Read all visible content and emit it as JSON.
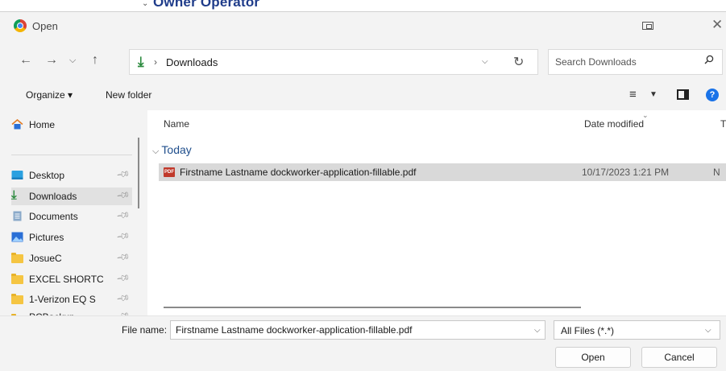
{
  "background_window": {
    "partial_title": "Owner Operator"
  },
  "dialog": {
    "title": "Open",
    "nav": {
      "back_icon": "arrow-left-icon",
      "forward_icon": "arrow-right-icon",
      "recent_icon": "chevron-down-icon",
      "up_icon": "arrow-up-icon"
    },
    "address": {
      "location": "Downloads",
      "separator": "›"
    },
    "search": {
      "placeholder": "Search Downloads"
    },
    "toolbar": {
      "organize": "Organize ▾",
      "new_folder": "New folder"
    },
    "nav_pane": {
      "items": [
        {
          "label": "Home",
          "icon": "home-icon"
        },
        {
          "label": "Desktop",
          "icon": "desktop-icon",
          "pinned": true
        },
        {
          "label": "Downloads",
          "icon": "downloads-icon",
          "pinned": true,
          "selected": true
        },
        {
          "label": "Documents",
          "icon": "documents-icon",
          "pinned": true
        },
        {
          "label": "Pictures",
          "icon": "pictures-icon",
          "pinned": true
        },
        {
          "label": "JosueC",
          "icon": "folder-icon",
          "pinned": true
        },
        {
          "label": "EXCEL SHORTC",
          "icon": "folder-icon",
          "pinned": true
        },
        {
          "label": "1-Verizon EQ S",
          "icon": "folder-icon",
          "pinned": true
        },
        {
          "label": "PCBackup",
          "icon": "folder-icon",
          "pinned": true
        }
      ]
    },
    "file_list": {
      "columns": {
        "name": "Name",
        "date": "Date modified",
        "type_partial": "T"
      },
      "groups": [
        {
          "label": "Today",
          "files": [
            {
              "name": "Firstname Lastname dockworker-application-fillable.pdf",
              "date_modified": "10/17/2023 1:21 PM",
              "type_partial": "N",
              "icon": "pdf-icon",
              "icon_text": "PDF"
            }
          ]
        }
      ]
    },
    "file_name": {
      "label": "File name:",
      "value": "Firstname Lastname dockworker-application-fillable.pdf"
    },
    "file_type": {
      "selected": "All Files (*.*)"
    },
    "buttons": {
      "open": "Open",
      "cancel": "Cancel"
    },
    "colors": {
      "accent": "#1a73e8",
      "selection": "#d9d9d9",
      "group_header": "#1f4e8c",
      "downloads_green": "#2b8a3e"
    }
  }
}
